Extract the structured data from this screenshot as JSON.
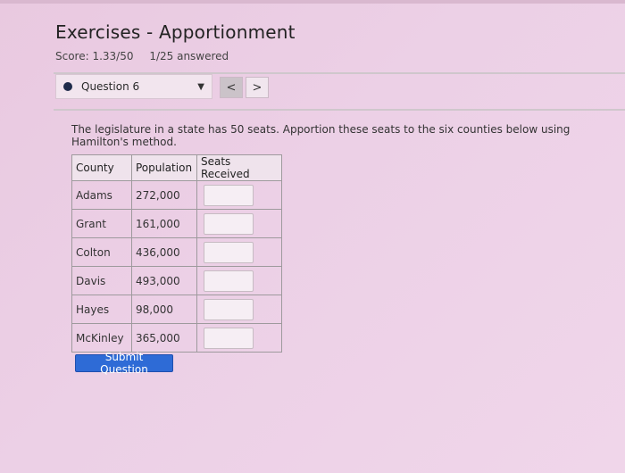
{
  "header": {
    "title": "Exercises - Apportionment",
    "score": "Score: 1.33/50",
    "answered": "1/25 answered"
  },
  "question_nav": {
    "selected_question": "Question 6",
    "prev_symbol": "<",
    "next_symbol": ">"
  },
  "instructions": "The legislature in a state has 50 seats. Apportion these seats to the six counties below using Hamilton's method.",
  "table": {
    "headers": [
      "County",
      "Population",
      "Seats Received"
    ],
    "rows": [
      {
        "county": "Adams",
        "population": "272,000",
        "seats": ""
      },
      {
        "county": "Grant",
        "population": "161,000",
        "seats": ""
      },
      {
        "county": "Colton",
        "population": "436,000",
        "seats": ""
      },
      {
        "county": "Davis",
        "population": "493,000",
        "seats": ""
      },
      {
        "county": "Hayes",
        "population": "98,000",
        "seats": ""
      },
      {
        "county": "McKinley",
        "population": "365,000",
        "seats": ""
      }
    ]
  },
  "submit_label": "Submit Question",
  "colors": {
    "accent": "#2e6bd6",
    "background": "#ecd0e6"
  }
}
